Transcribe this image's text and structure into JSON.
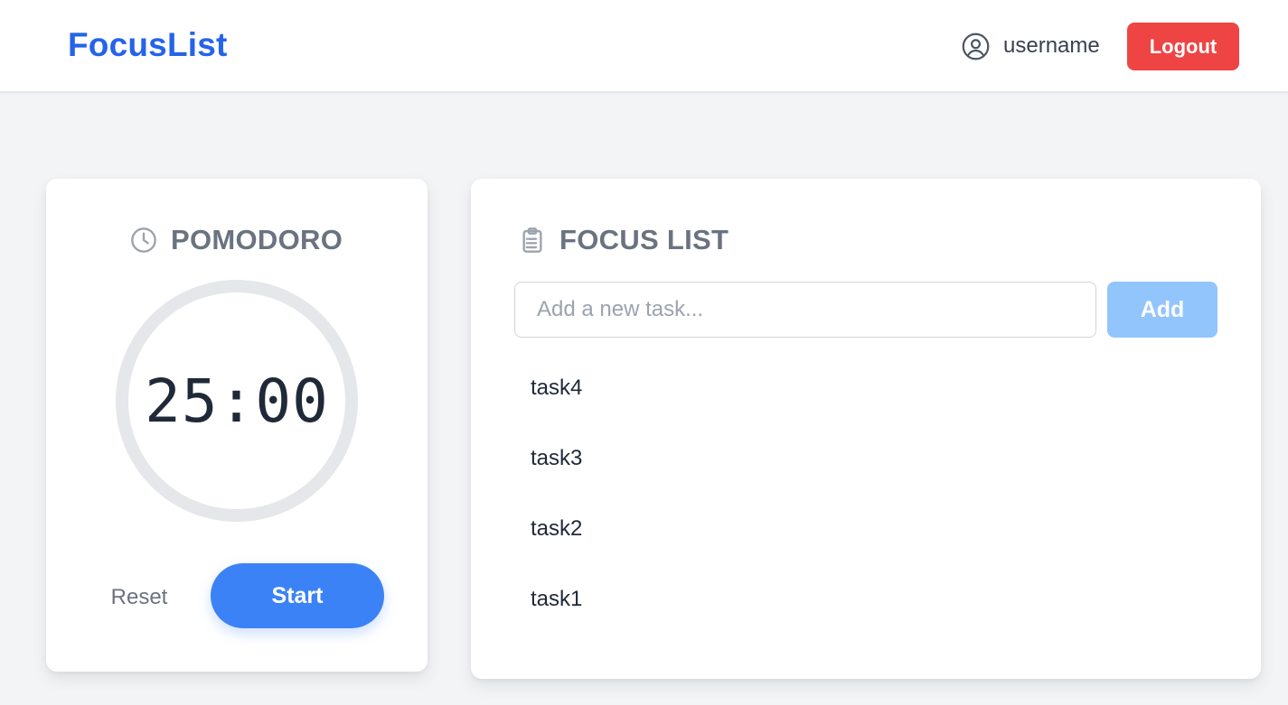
{
  "header": {
    "brand": "FocusList",
    "username": "username",
    "logout_label": "Logout",
    "icons": {
      "user": "user-circle-icon"
    }
  },
  "pomodoro": {
    "title": "POMODORO",
    "icon": "clock-icon",
    "time": "25:00",
    "reset_label": "Reset",
    "start_label": "Start"
  },
  "focus_list": {
    "title": "FOCUS LIST",
    "icon": "clipboard-list-icon",
    "input_placeholder": "Add a new task...",
    "input_value": "",
    "add_label": "Add",
    "tasks": [
      {
        "label": "task4"
      },
      {
        "label": "task3"
      },
      {
        "label": "task2"
      },
      {
        "label": "task1"
      }
    ]
  },
  "colors": {
    "brand": "#2563eb",
    "logout": "#ef4444",
    "start": "#3b82f6",
    "add_disabled": "#93c5fd",
    "background": "#f3f4f6"
  }
}
